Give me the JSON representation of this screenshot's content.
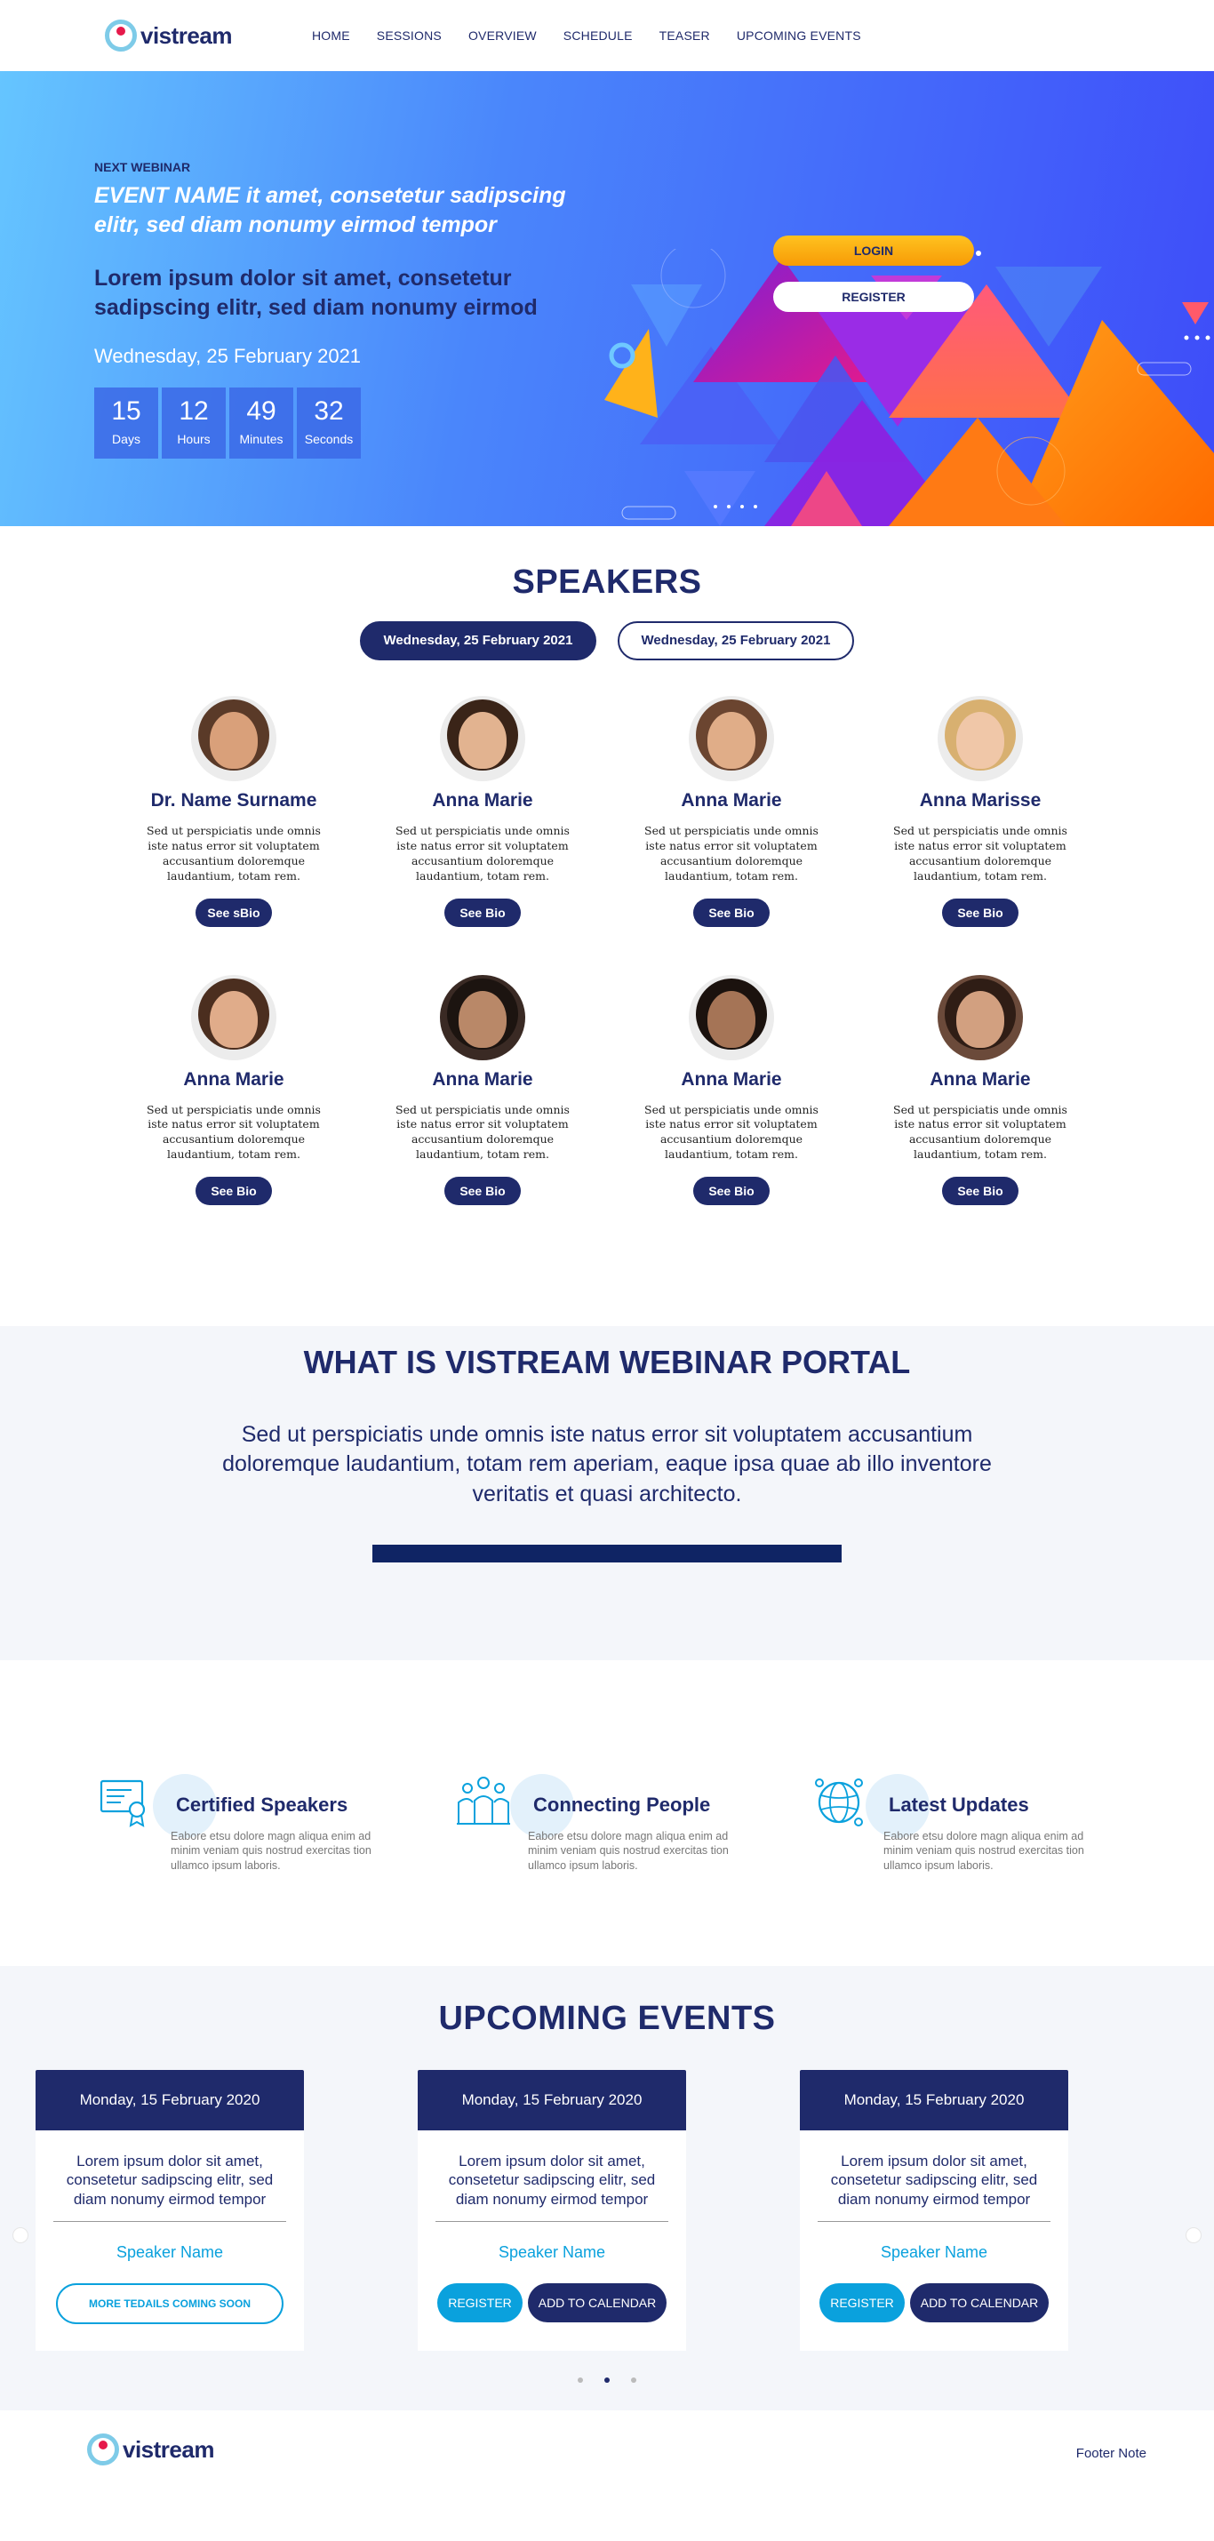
{
  "brand": {
    "logo_text": "vistream"
  },
  "nav": {
    "items": [
      "HOME",
      "SESSIONS",
      "OVERVIEW",
      "SCHEDULE",
      "TEASER",
      "UPCOMING EVENTS"
    ]
  },
  "hero": {
    "kicker": "NEXT WEBINAR",
    "event_name": "EVENT NAME it amet, consetetur sadipscing elitr, sed diam nonumy eirmod tempor",
    "lorem": "Lorem ipsum dolor sit amet, consetetur sadipscing elitr, sed diam nonumy eirmod",
    "date": "Wednesday, 25 February 2021",
    "countdown": [
      {
        "value": "15",
        "label": "Days"
      },
      {
        "value": "12",
        "label": "Hours"
      },
      {
        "value": "49",
        "label": "Minutes"
      },
      {
        "value": "32",
        "label": "Seconds"
      }
    ],
    "login_label": "LOGIN",
    "register_label": "REGISTER"
  },
  "speakers": {
    "title": "SPEAKERS",
    "tabs": [
      {
        "label": "Wednesday, 25 February 2021",
        "active": true
      },
      {
        "label": "Wednesday, 25 February 2021",
        "active": false
      }
    ],
    "bio_text": "Sed ut perspiciatis unde omnis iste natus error sit voluptatem accusantium doloremque laudantium, totam rem.",
    "list": [
      {
        "name": "Dr. Name Surname",
        "button": "See sBio",
        "skin": "#d9a07a",
        "hair": "#5a3a28",
        "bg": "#ececec"
      },
      {
        "name": "Anna Marie",
        "button": "See Bio",
        "skin": "#e2b390",
        "hair": "#3a2418",
        "bg": "#ececec"
      },
      {
        "name": "Anna Marie",
        "button": "See Bio",
        "skin": "#e0ad88",
        "hair": "#6b4530",
        "bg": "#ececec"
      },
      {
        "name": "Anna Marisse",
        "button": "See Bio",
        "skin": "#f0c7a8",
        "hair": "#d8b070",
        "bg": "#ececec"
      },
      {
        "name": "Anna Marie",
        "button": "See Bio",
        "skin": "#e0ac8a",
        "hair": "#4b2e1f",
        "bg": "#ececec"
      },
      {
        "name": "Anna Marie",
        "button": "See Bio",
        "skin": "#b98868",
        "hair": "#1c1410",
        "bg": "#3a2a24"
      },
      {
        "name": "Anna Marie",
        "button": "See Bio",
        "skin": "#a57456",
        "hair": "#1b120e",
        "bg": "#ececec"
      },
      {
        "name": "Anna Marie",
        "button": "See Bio",
        "skin": "#d2a080",
        "hair": "#2f1d15",
        "bg": "#6b4a3a"
      }
    ]
  },
  "whatis": {
    "title": "WHAT IS VISTREAM WEBINAR PORTAL",
    "text": "Sed ut perspiciatis unde omnis iste natus error sit voluptatem accusantium doloremque laudantium, totam rem aperiam, eaque ipsa quae ab illo inventore veritatis et quasi architecto."
  },
  "features": [
    {
      "title": "Certified Speakers",
      "icon": "certificate-icon",
      "text": "Eabore etsu dolore magn aliqua enim ad minim veniam quis nostrud exercitas tion ullamco ipsum laboris."
    },
    {
      "title": "Connecting People",
      "icon": "people-icon",
      "text": "Eabore etsu dolore magn aliqua enim ad minim veniam quis nostrud exercitas tion ullamco ipsum laboris."
    },
    {
      "title": "Latest Updates",
      "icon": "globe-icon",
      "text": "Eabore etsu dolore magn aliqua enim ad minim veniam quis nostrud exercitas tion ullamco ipsum laboris."
    }
  ],
  "upcoming": {
    "title": "UPCOMING EVENTS",
    "events": [
      {
        "date": "Monday, 15 February 2020",
        "desc": "Lorem ipsum dolor sit amet, consetetur sadipscing elitr, sed diam nonumy eirmod tempor",
        "speaker": "Speaker Name",
        "more_label": "MORE TEDAILS COMING SOON"
      },
      {
        "date": "Monday, 15 February 2020",
        "desc": "Lorem ipsum dolor sit amet, consetetur sadipscing elitr, sed diam nonumy eirmod tempor",
        "speaker": "Speaker Name",
        "register_label": "REGISTER",
        "calendar_label": "ADD TO CALENDAR"
      },
      {
        "date": "Monday, 15 February 2020",
        "desc": "Lorem ipsum dolor sit amet, consetetur sadipscing elitr, sed diam nonumy eirmod tempor",
        "speaker": "Speaker Name",
        "register_label": "REGISTER",
        "calendar_label": "ADD TO CALENDAR"
      }
    ],
    "active_dot": 1
  },
  "footer": {
    "note": "Footer Note"
  },
  "colors": {
    "navy": "#1f2a6b",
    "accent_blue": "#0aa1dd",
    "login_orange": "#f9b112",
    "hero_start": "#65c5ff",
    "hero_end": "#3e4cf9"
  }
}
